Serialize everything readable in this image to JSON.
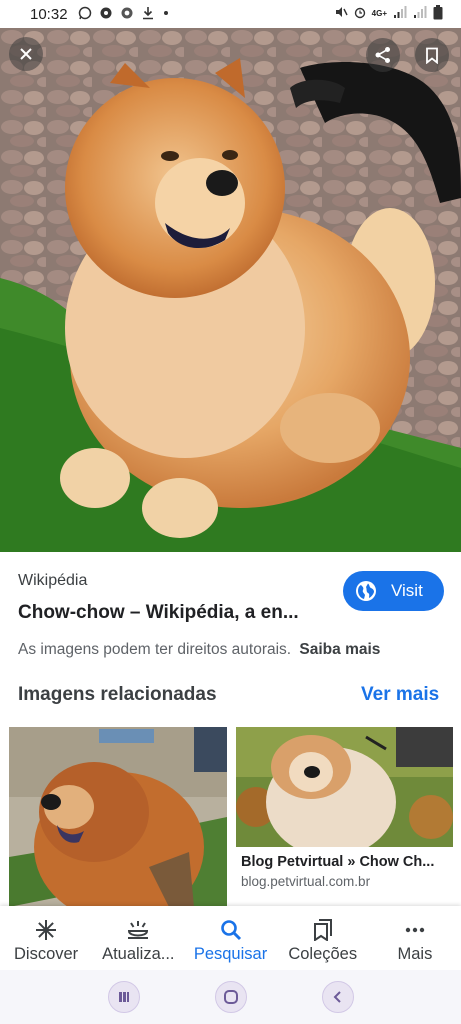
{
  "status_bar": {
    "time": "10:32",
    "left_icons": [
      "whatsapp-icon",
      "vpn-icon",
      "chrome-icon",
      "download-icon",
      "dot-icon"
    ],
    "right_icons": [
      "mute-icon",
      "alarm-icon",
      "4g-plus-icon",
      "signal-icon",
      "signal-icon",
      "battery-icon"
    ],
    "network_label": "4G+"
  },
  "image_viewer": {
    "close_icon": "close-icon",
    "share_icon": "share-icon",
    "bookmark_icon": "bookmark-icon"
  },
  "source": {
    "name": "Wikipédia",
    "title": "Chow-chow – Wikipédia, a en...",
    "visit_label": "Visit",
    "visit_icon": "globe-icon",
    "copyright_text": "As imagens podem ter direitos autorais.",
    "learn_more": "Saiba mais"
  },
  "related": {
    "title": "Imagens relacionadas",
    "see_more": "Ver mais",
    "items": [
      {
        "caption": "",
        "url": ""
      },
      {
        "caption": "Blog Petvirtual » Chow Ch...",
        "url": "blog.petvirtual.com.br"
      }
    ]
  },
  "bottom_nav": {
    "items": [
      {
        "label": "Discover",
        "icon": "asterisk-icon",
        "active": false
      },
      {
        "label": "Atualiza...",
        "icon": "updates-icon",
        "active": false
      },
      {
        "label": "Pesquisar",
        "icon": "search-icon",
        "active": true
      },
      {
        "label": "Coleções",
        "icon": "collections-icon",
        "active": false
      },
      {
        "label": "Mais",
        "icon": "more-icon",
        "active": false
      }
    ]
  },
  "system_nav": {
    "buttons": [
      "recents-icon",
      "home-icon",
      "back-icon"
    ]
  },
  "colors": {
    "accent": "#1a73e8",
    "text_primary": "#202124",
    "text_secondary": "#5f6368"
  }
}
